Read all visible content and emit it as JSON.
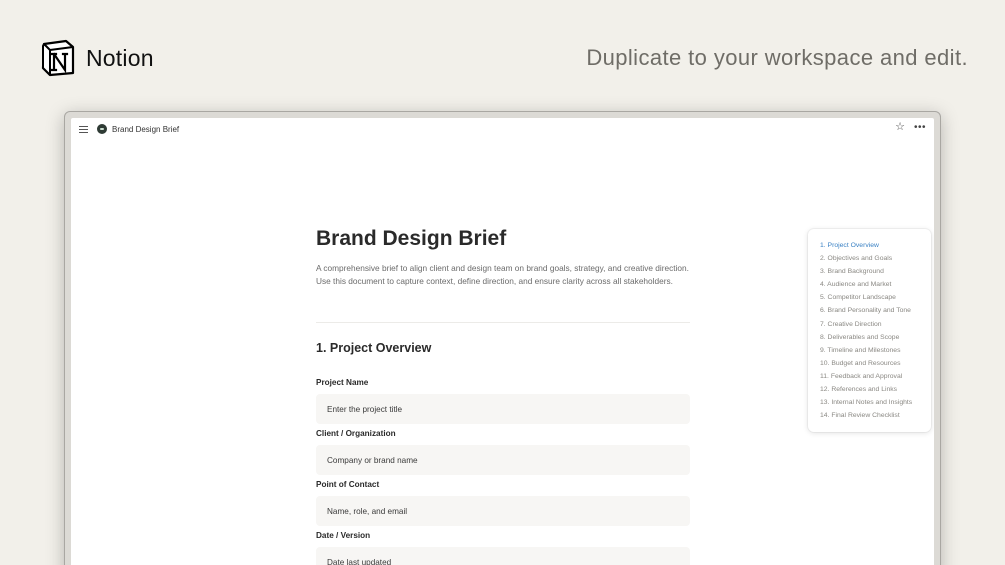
{
  "brand": {
    "name": "Notion",
    "logo_icon": "notion-logo-icon"
  },
  "tagline": "Duplicate to your workspace and edit.",
  "topbar": {
    "breadcrumb": "Brand Design Brief",
    "icons": [
      "menu-icon",
      "page-icon",
      "star-icon",
      "more-icon"
    ]
  },
  "doc": {
    "title": "Brand Design Brief",
    "description": "A comprehensive brief to align client and design team on brand goals, strategy, and creative direction. Use this document to capture context, define direction, and ensure clarity across all stakeholders.",
    "section_heading": "1. Project Overview",
    "fields": [
      {
        "label": "Project Name",
        "placeholder": "Enter the project title"
      },
      {
        "label": "Client / Organization",
        "placeholder": "Company or brand name"
      },
      {
        "label": "Point of Contact",
        "placeholder": "Name, role, and email"
      },
      {
        "label": "Date / Version",
        "placeholder": "Date last updated"
      }
    ]
  },
  "toc": {
    "active_color": "#3b82c4",
    "items": [
      "1. Project Overview",
      "2. Objectives and Goals",
      "3. Brand Background",
      "4. Audience and Market",
      "5. Competitor Landscape",
      "6. Brand Personality and Tone",
      "7. Creative Direction",
      "8. Deliverables and Scope",
      "9. Timeline and Milestones",
      "10. Budget and Resources",
      "11. Feedback and Approval",
      "12. References and Links",
      "13. Internal Notes and Insights",
      "14. Final Review Checklist"
    ]
  }
}
